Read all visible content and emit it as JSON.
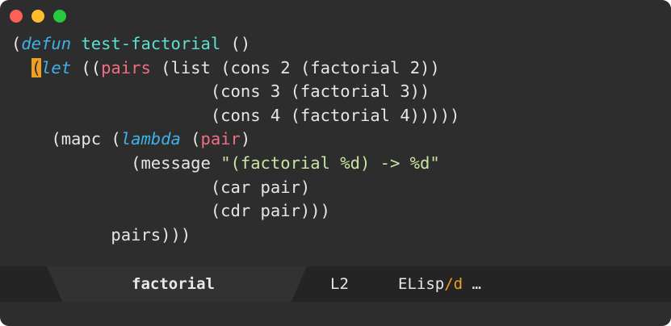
{
  "colors": {
    "background": "#2d2d2d",
    "keyword": "#3fb0e8",
    "function_name": "#5ce0d0",
    "variable": "#f26e84",
    "string": "#c8e6a0",
    "cursor": "#f0a020"
  },
  "window_controls": [
    "close",
    "minimize",
    "zoom"
  ],
  "editor": {
    "l1": {
      "a": "(",
      "kw": "defun",
      "b": " ",
      "name": "test-factorial",
      "c": " ()"
    },
    "l2": {
      "indent": "  ",
      "cursor": "(",
      "kw": "let",
      "a": " ((",
      "var": "pairs",
      "b": " (list (cons 2 (factorial 2))"
    },
    "l3": "                    (cons 3 (factorial 3))",
    "l4": "                    (cons 4 (factorial 4)))))",
    "l5": {
      "a": "    (mapc (",
      "kw": "lambda",
      "b": " (",
      "var": "pair",
      "c": ")"
    },
    "l6": {
      "a": "            (message ",
      "str": "\"(factorial %d) -> %d\""
    },
    "l7": "                    (car pair)",
    "l8": "                    (cdr pair)))",
    "l9": "          pairs)))"
  },
  "modeline": {
    "buffer": "factorial",
    "line": "L2",
    "mode": "ELisp",
    "sep": "/",
    "submode": "d",
    "ellipsis": " …"
  }
}
